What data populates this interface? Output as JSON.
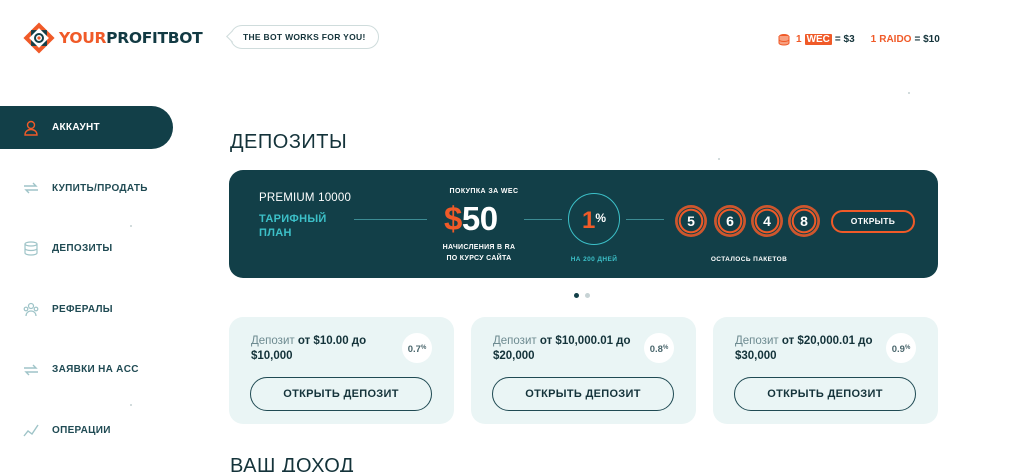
{
  "header": {
    "logo_text_accent": "YOUR",
    "logo_text_main": "PROFITBOT",
    "slogan": "THE BOT WORKS FOR YOU!",
    "rates": {
      "wec_amount": "1",
      "wec_label": "WEC",
      "wec_value": "= $3",
      "raido_amount": "1",
      "raido_label": "RAIDO",
      "raido_value": "= $10"
    }
  },
  "sidebar": {
    "items": [
      {
        "label": "АККАУНТ",
        "icon": "user-icon",
        "active": true
      },
      {
        "label": "КУПИТЬ/ПРОДАТЬ",
        "icon": "exchange-icon",
        "active": false
      },
      {
        "label": "ДЕПОЗИТЫ",
        "icon": "coins-icon",
        "active": false
      },
      {
        "label": "РЕФЕРАЛЫ",
        "icon": "referrals-icon",
        "active": false
      },
      {
        "label": "ЗАЯВКИ НА ACC",
        "icon": "transfer-icon",
        "active": false
      },
      {
        "label": "ОПЕРАЦИИ",
        "icon": "chart-line-icon",
        "active": false
      }
    ]
  },
  "main": {
    "title": "ДЕПОЗИТЫ",
    "banner": {
      "plan_name": "PREMIUM 10000",
      "plan_label": "ТАРИФНЫЙ ПЛАН",
      "buy_label": "ПОКУПКА ЗА WEC",
      "price_currency": "$",
      "price_value": "50",
      "accrual_line1": "НАЧИСЛЕНИЯ В RA",
      "accrual_line2": "ПО КУРСУ САЙТА",
      "percent_value": "1",
      "percent_sign": "%",
      "days": "НА 200 ДНЕЙ",
      "packages_digits": [
        "5",
        "6",
        "4",
        "8"
      ],
      "packages_label": "ОСТАЛОСЬ ПАКЕТОВ",
      "open_label": "ОТКРЫТЬ"
    },
    "carousel": {
      "total": 2,
      "active": 1
    },
    "deposits": [
      {
        "prefix": "Депозит",
        "range": "от $10.00 до $10,000",
        "rate": "0.7",
        "rate_sign": "%",
        "button": "ОТКРЫТЬ ДЕПОЗИТ"
      },
      {
        "prefix": "Депозит",
        "range": "от $10,000.01 до $20,000",
        "rate": "0.8",
        "rate_sign": "%",
        "button": "ОТКРЫТЬ ДЕПОЗИТ"
      },
      {
        "prefix": "Депозит",
        "range": "от $20,000.01 до $30,000",
        "rate": "0.9",
        "rate_sign": "%",
        "button": "ОТКРЫТЬ ДЕПОЗИТ"
      }
    ],
    "income_title": "ВАШ ДОХОД"
  },
  "colors": {
    "brand_dark": "#123f48",
    "accent_orange": "#f05a28",
    "accent_teal": "#3cc0c8",
    "card_bg": "#eaf5f5"
  }
}
